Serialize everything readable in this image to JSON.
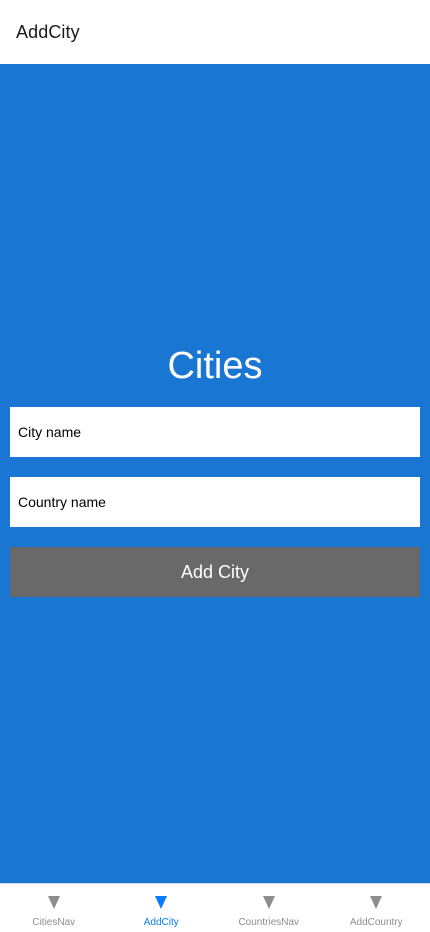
{
  "header": {
    "title": "AddCity"
  },
  "main": {
    "heading": "Cities",
    "city_input": {
      "value": "",
      "placeholder": "City name"
    },
    "country_input": {
      "value": "",
      "placeholder": "Country name"
    },
    "add_button_label": "Add City"
  },
  "tabbar": {
    "active_color": "#0a7aff",
    "inactive_color": "#8e8e8e",
    "tabs": [
      {
        "label": "CitiesNav",
        "icon": "triangle-down-icon"
      },
      {
        "label": "AddCity",
        "icon": "triangle-down-icon",
        "active": true
      },
      {
        "label": "CountriesNav",
        "icon": "triangle-down-icon"
      },
      {
        "label": "AddCountry",
        "icon": "triangle-down-icon"
      }
    ]
  },
  "colors": {
    "main_background": "#1976d2",
    "button_background": "#696969"
  }
}
